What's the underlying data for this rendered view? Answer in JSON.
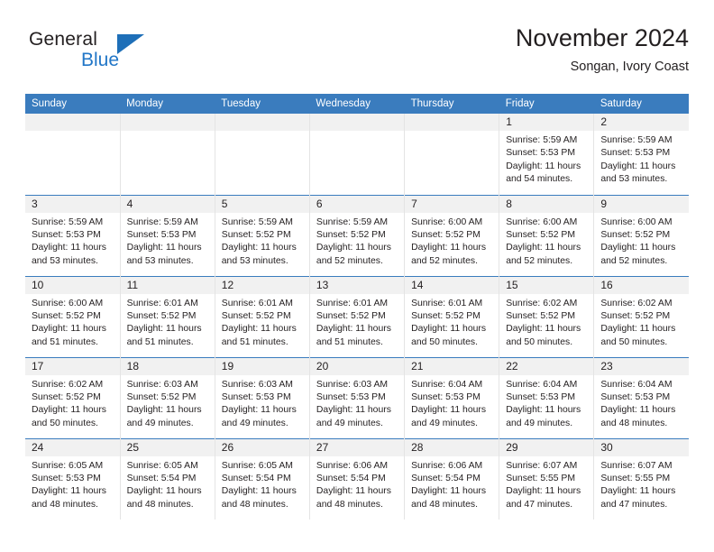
{
  "logo": {
    "word1": "General",
    "word2": "Blue",
    "triangle_color": "#1e6fb8",
    "blue_color": "#2176c7"
  },
  "header": {
    "title": "November 2024",
    "subtitle": "Songan, Ivory Coast",
    "header_bg": "#3a7cbe",
    "daynum_bg": "#f1f1f1"
  },
  "weekdays": [
    "Sunday",
    "Monday",
    "Tuesday",
    "Wednesday",
    "Thursday",
    "Friday",
    "Saturday"
  ],
  "labels": {
    "sunrise": "Sunrise:",
    "sunset": "Sunset:",
    "daylight": "Daylight:"
  },
  "weeks": [
    [
      {
        "day": "",
        "empty": true
      },
      {
        "day": "",
        "empty": true
      },
      {
        "day": "",
        "empty": true
      },
      {
        "day": "",
        "empty": true
      },
      {
        "day": "",
        "empty": true
      },
      {
        "day": "1",
        "sunrise": "Sunrise: 5:59 AM",
        "sunset": "Sunset: 5:53 PM",
        "daylight1": "Daylight: 11 hours",
        "daylight2": "and 54 minutes."
      },
      {
        "day": "2",
        "sunrise": "Sunrise: 5:59 AM",
        "sunset": "Sunset: 5:53 PM",
        "daylight1": "Daylight: 11 hours",
        "daylight2": "and 53 minutes."
      }
    ],
    [
      {
        "day": "3",
        "sunrise": "Sunrise: 5:59 AM",
        "sunset": "Sunset: 5:53 PM",
        "daylight1": "Daylight: 11 hours",
        "daylight2": "and 53 minutes."
      },
      {
        "day": "4",
        "sunrise": "Sunrise: 5:59 AM",
        "sunset": "Sunset: 5:53 PM",
        "daylight1": "Daylight: 11 hours",
        "daylight2": "and 53 minutes."
      },
      {
        "day": "5",
        "sunrise": "Sunrise: 5:59 AM",
        "sunset": "Sunset: 5:52 PM",
        "daylight1": "Daylight: 11 hours",
        "daylight2": "and 53 minutes."
      },
      {
        "day": "6",
        "sunrise": "Sunrise: 5:59 AM",
        "sunset": "Sunset: 5:52 PM",
        "daylight1": "Daylight: 11 hours",
        "daylight2": "and 52 minutes."
      },
      {
        "day": "7",
        "sunrise": "Sunrise: 6:00 AM",
        "sunset": "Sunset: 5:52 PM",
        "daylight1": "Daylight: 11 hours",
        "daylight2": "and 52 minutes."
      },
      {
        "day": "8",
        "sunrise": "Sunrise: 6:00 AM",
        "sunset": "Sunset: 5:52 PM",
        "daylight1": "Daylight: 11 hours",
        "daylight2": "and 52 minutes."
      },
      {
        "day": "9",
        "sunrise": "Sunrise: 6:00 AM",
        "sunset": "Sunset: 5:52 PM",
        "daylight1": "Daylight: 11 hours",
        "daylight2": "and 52 minutes."
      }
    ],
    [
      {
        "day": "10",
        "sunrise": "Sunrise: 6:00 AM",
        "sunset": "Sunset: 5:52 PM",
        "daylight1": "Daylight: 11 hours",
        "daylight2": "and 51 minutes."
      },
      {
        "day": "11",
        "sunrise": "Sunrise: 6:01 AM",
        "sunset": "Sunset: 5:52 PM",
        "daylight1": "Daylight: 11 hours",
        "daylight2": "and 51 minutes."
      },
      {
        "day": "12",
        "sunrise": "Sunrise: 6:01 AM",
        "sunset": "Sunset: 5:52 PM",
        "daylight1": "Daylight: 11 hours",
        "daylight2": "and 51 minutes."
      },
      {
        "day": "13",
        "sunrise": "Sunrise: 6:01 AM",
        "sunset": "Sunset: 5:52 PM",
        "daylight1": "Daylight: 11 hours",
        "daylight2": "and 51 minutes."
      },
      {
        "day": "14",
        "sunrise": "Sunrise: 6:01 AM",
        "sunset": "Sunset: 5:52 PM",
        "daylight1": "Daylight: 11 hours",
        "daylight2": "and 50 minutes."
      },
      {
        "day": "15",
        "sunrise": "Sunrise: 6:02 AM",
        "sunset": "Sunset: 5:52 PM",
        "daylight1": "Daylight: 11 hours",
        "daylight2": "and 50 minutes."
      },
      {
        "day": "16",
        "sunrise": "Sunrise: 6:02 AM",
        "sunset": "Sunset: 5:52 PM",
        "daylight1": "Daylight: 11 hours",
        "daylight2": "and 50 minutes."
      }
    ],
    [
      {
        "day": "17",
        "sunrise": "Sunrise: 6:02 AM",
        "sunset": "Sunset: 5:52 PM",
        "daylight1": "Daylight: 11 hours",
        "daylight2": "and 50 minutes."
      },
      {
        "day": "18",
        "sunrise": "Sunrise: 6:03 AM",
        "sunset": "Sunset: 5:52 PM",
        "daylight1": "Daylight: 11 hours",
        "daylight2": "and 49 minutes."
      },
      {
        "day": "19",
        "sunrise": "Sunrise: 6:03 AM",
        "sunset": "Sunset: 5:53 PM",
        "daylight1": "Daylight: 11 hours",
        "daylight2": "and 49 minutes."
      },
      {
        "day": "20",
        "sunrise": "Sunrise: 6:03 AM",
        "sunset": "Sunset: 5:53 PM",
        "daylight1": "Daylight: 11 hours",
        "daylight2": "and 49 minutes."
      },
      {
        "day": "21",
        "sunrise": "Sunrise: 6:04 AM",
        "sunset": "Sunset: 5:53 PM",
        "daylight1": "Daylight: 11 hours",
        "daylight2": "and 49 minutes."
      },
      {
        "day": "22",
        "sunrise": "Sunrise: 6:04 AM",
        "sunset": "Sunset: 5:53 PM",
        "daylight1": "Daylight: 11 hours",
        "daylight2": "and 49 minutes."
      },
      {
        "day": "23",
        "sunrise": "Sunrise: 6:04 AM",
        "sunset": "Sunset: 5:53 PM",
        "daylight1": "Daylight: 11 hours",
        "daylight2": "and 48 minutes."
      }
    ],
    [
      {
        "day": "24",
        "sunrise": "Sunrise: 6:05 AM",
        "sunset": "Sunset: 5:53 PM",
        "daylight1": "Daylight: 11 hours",
        "daylight2": "and 48 minutes."
      },
      {
        "day": "25",
        "sunrise": "Sunrise: 6:05 AM",
        "sunset": "Sunset: 5:54 PM",
        "daylight1": "Daylight: 11 hours",
        "daylight2": "and 48 minutes."
      },
      {
        "day": "26",
        "sunrise": "Sunrise: 6:05 AM",
        "sunset": "Sunset: 5:54 PM",
        "daylight1": "Daylight: 11 hours",
        "daylight2": "and 48 minutes."
      },
      {
        "day": "27",
        "sunrise": "Sunrise: 6:06 AM",
        "sunset": "Sunset: 5:54 PM",
        "daylight1": "Daylight: 11 hours",
        "daylight2": "and 48 minutes."
      },
      {
        "day": "28",
        "sunrise": "Sunrise: 6:06 AM",
        "sunset": "Sunset: 5:54 PM",
        "daylight1": "Daylight: 11 hours",
        "daylight2": "and 48 minutes."
      },
      {
        "day": "29",
        "sunrise": "Sunrise: 6:07 AM",
        "sunset": "Sunset: 5:55 PM",
        "daylight1": "Daylight: 11 hours",
        "daylight2": "and 47 minutes."
      },
      {
        "day": "30",
        "sunrise": "Sunrise: 6:07 AM",
        "sunset": "Sunset: 5:55 PM",
        "daylight1": "Daylight: 11 hours",
        "daylight2": "and 47 minutes."
      }
    ]
  ]
}
